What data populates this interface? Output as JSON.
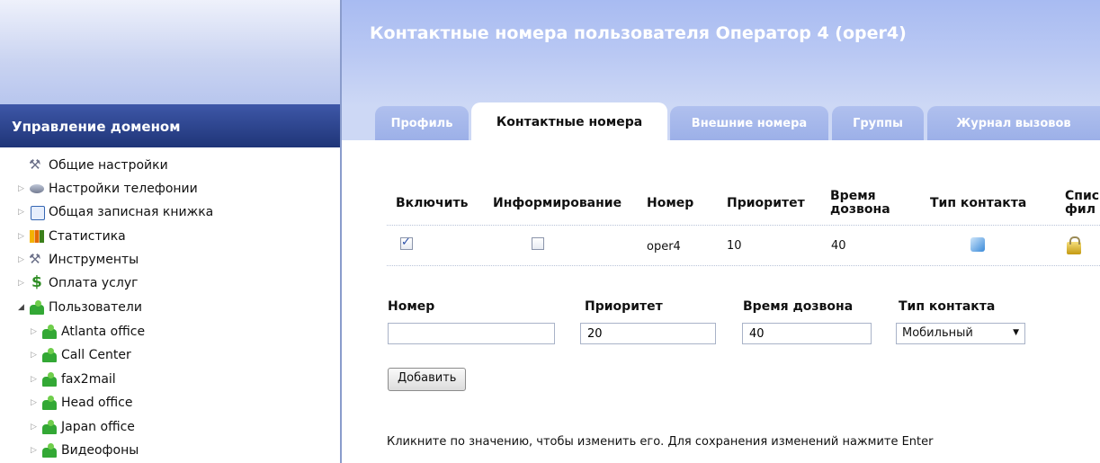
{
  "page_title": "Контактные номера пользователя Оператор 4 (oper4)",
  "sidebar": {
    "header": "Управление доменом",
    "items": [
      {
        "label": "Общие настройки",
        "icon": "tools-icon"
      },
      {
        "label": "Настройки телефонии",
        "icon": "phone-settings-icon"
      },
      {
        "label": "Общая записная книжка",
        "icon": "address-book-icon"
      },
      {
        "label": "Статистика",
        "icon": "statistics-icon"
      },
      {
        "label": "Инструменты",
        "icon": "tools-icon"
      },
      {
        "label": "Оплата услуг",
        "icon": "dollar-icon"
      },
      {
        "label": "Пользователи",
        "icon": "users-icon"
      },
      {
        "label": "Atlanta office",
        "icon": "users-icon"
      },
      {
        "label": "Call Center",
        "icon": "users-icon"
      },
      {
        "label": "fax2mail",
        "icon": "users-icon"
      },
      {
        "label": "Head office",
        "icon": "users-icon"
      },
      {
        "label": "Japan office",
        "icon": "users-icon"
      },
      {
        "label": "Видеофоны",
        "icon": "users-icon"
      }
    ]
  },
  "tabs": [
    {
      "label": "Профиль",
      "active": false
    },
    {
      "label": "Контактные номера",
      "active": true
    },
    {
      "label": "Внешние номера",
      "active": false
    },
    {
      "label": "Группы",
      "active": false
    },
    {
      "label": "Журнал вызовов",
      "active": false
    }
  ],
  "table": {
    "headers": {
      "enable": "Включить",
      "notify": "Информирование",
      "number": "Номер",
      "priority": "Приоритет",
      "ring_time_1": "Время",
      "ring_time_2": "дозвона",
      "contact_type": "Тип контакта",
      "filter_list_1": "Спис",
      "filter_list_2": "фил"
    },
    "rows": [
      {
        "enabled": true,
        "notify": false,
        "number": "oper4",
        "priority": "10",
        "ring_time": "40",
        "contact_type_icon": "computer-icon",
        "filter_icon": "lock-icon"
      }
    ]
  },
  "form": {
    "number_label": "Номер",
    "number_value": "",
    "priority_label": "Приоритет",
    "priority_value": "20",
    "ring_time_label": "Время дозвона",
    "ring_time_value": "40",
    "contact_type_label": "Тип контакта",
    "contact_type_value": "Мобильный",
    "add_button": "Добавить"
  },
  "hint": "Кликните по значению, чтобы изменить его. Для сохранения изменений нажмите Enter",
  "colors": {
    "sidebar_header": "#2a4190",
    "topbar": "#b3c4f2",
    "tab_inactive": "#a4b6ea",
    "title_text": "#ffffff"
  }
}
